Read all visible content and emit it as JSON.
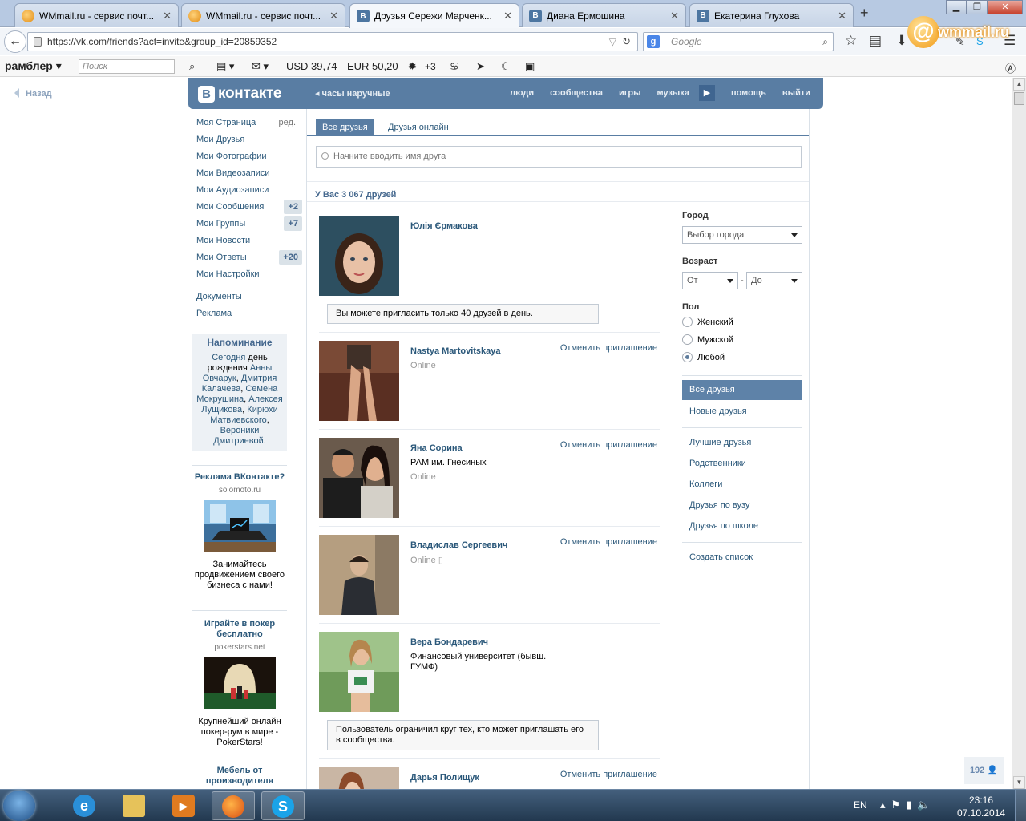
{
  "browser": {
    "tabs": [
      {
        "title": "WMmail.ru - сервис почт...",
        "icon": "wmmail-favicon",
        "active": false
      },
      {
        "title": "WMmail.ru - сервис почт...",
        "icon": "wmmail-favicon",
        "active": false
      },
      {
        "title": "Друзья Сережи Марченк...",
        "icon": "vk-favicon",
        "active": true
      },
      {
        "title": "Диана Ермошина",
        "icon": "vk-favicon",
        "active": false
      },
      {
        "title": "Екатерина Глухова",
        "icon": "vk-favicon",
        "active": false
      }
    ],
    "new_tab": "+",
    "url": "https://vk.com/friends?act=invite&group_id=20859352",
    "search_engine": "Google",
    "search_placeholder": "Google",
    "wm_logo_text": "wmmail.ru"
  },
  "rambler": {
    "logo": "рамблер",
    "search_placeholder": "Поиск",
    "usd": "USD 39,74",
    "eur": "EUR 50,20",
    "weather": "+3"
  },
  "page": {
    "back_label": "Назад",
    "vk_logo": "контакте",
    "status": "часы наручные",
    "top_nav": [
      "люди",
      "сообщества",
      "игры",
      "музыка",
      "помощь",
      "выйти"
    ],
    "left_menu": [
      {
        "label": "Моя Страница",
        "extra": "ред."
      },
      {
        "label": "Мои Друзья",
        "extra": ""
      },
      {
        "label": "Мои Фотографии",
        "extra": ""
      },
      {
        "label": "Мои Видеозаписи",
        "extra": ""
      },
      {
        "label": "Мои Аудиозаписи",
        "extra": ""
      },
      {
        "label": "Мои Сообщения",
        "extra": "+2"
      },
      {
        "label": "Мои Группы",
        "extra": "+7"
      },
      {
        "label": "Мои Новости",
        "extra": ""
      },
      {
        "label": "Мои Ответы",
        "extra": "+20"
      },
      {
        "label": "Мои Настройки",
        "extra": ""
      }
    ],
    "left_menu_extra": [
      "Документы",
      "Реклама"
    ],
    "reminder": {
      "title": "Напоминание",
      "today": "Сегодня",
      "text1": " день рождения ",
      "names": [
        "Анны Овчарук",
        "Дмитрия Калачева",
        "Семена Мокрушина",
        "Алексея Лущикова",
        "Кирюхи Матвиевского",
        "Вероники Дмитриевой"
      ]
    },
    "ads": [
      {
        "title": "Реклама ВКонтакте?",
        "domain": "solomoto.ru",
        "desc": "Занимайтесь продвижением своего бизнеса с нами!"
      },
      {
        "title": "Играйте в покер бесплатно",
        "domain": "pokerstars.net",
        "desc": "Крупнейший онлайн покер-рум в мире - PokerStars!"
      },
      {
        "title": "Мебель от производителя",
        "domain": "",
        "desc": ""
      }
    ],
    "tabs": [
      "Все друзья",
      "Друзья онлайн"
    ],
    "search_placeholder": "Начните вводить имя друга",
    "friends_count": "У Вас 3 067 друзей",
    "cancel_invite": "Отменить приглашение",
    "friends": [
      {
        "name": "Юлія Єрмакова",
        "sub": "",
        "online": "",
        "invite": false,
        "notice": "Вы можете пригласить только 40 друзей в день."
      },
      {
        "name": "Nastya Martovitskaya",
        "sub": "",
        "online": "Online",
        "invite": true,
        "notice": ""
      },
      {
        "name": "Яна Сорина",
        "sub": "РАМ им. Гнесиных",
        "online": "Online",
        "invite": true,
        "notice": ""
      },
      {
        "name": "Владислав Сергеевич",
        "sub": "",
        "online": "Online",
        "invite": true,
        "notice": ""
      },
      {
        "name": "Вера Бондаревич",
        "sub": "Финансовый университет (бывш. ГУМФ)",
        "online": "",
        "invite": false,
        "notice": "Пользователь ограничил круг тех, кто может приглашать его в сообщества."
      },
      {
        "name": "Дарья Полищук",
        "sub": "",
        "online": "",
        "invite": true,
        "notice": ""
      }
    ],
    "filter": {
      "city_label": "Город",
      "city_value": "Выбор города",
      "age_label": "Возраст",
      "age_from": "От",
      "age_sep": "-",
      "age_to": "До",
      "sex_label": "Пол",
      "sex_options": [
        "Женский",
        "Мужской",
        "Любой"
      ],
      "sex_selected": 2,
      "lists_main": [
        "Все друзья",
        "Новые друзья"
      ],
      "lists": [
        "Лучшие друзья",
        "Родственники",
        "Коллеги",
        "Друзья по вузу",
        "Друзья по школе"
      ],
      "create_list": "Создать список"
    },
    "side_counter": "192"
  },
  "taskbar": {
    "lang": "EN",
    "time": "23:16",
    "date": "07.10.2014",
    "apps": [
      "internet-explorer",
      "file-explorer",
      "media-player",
      "firefox",
      "skype"
    ]
  }
}
